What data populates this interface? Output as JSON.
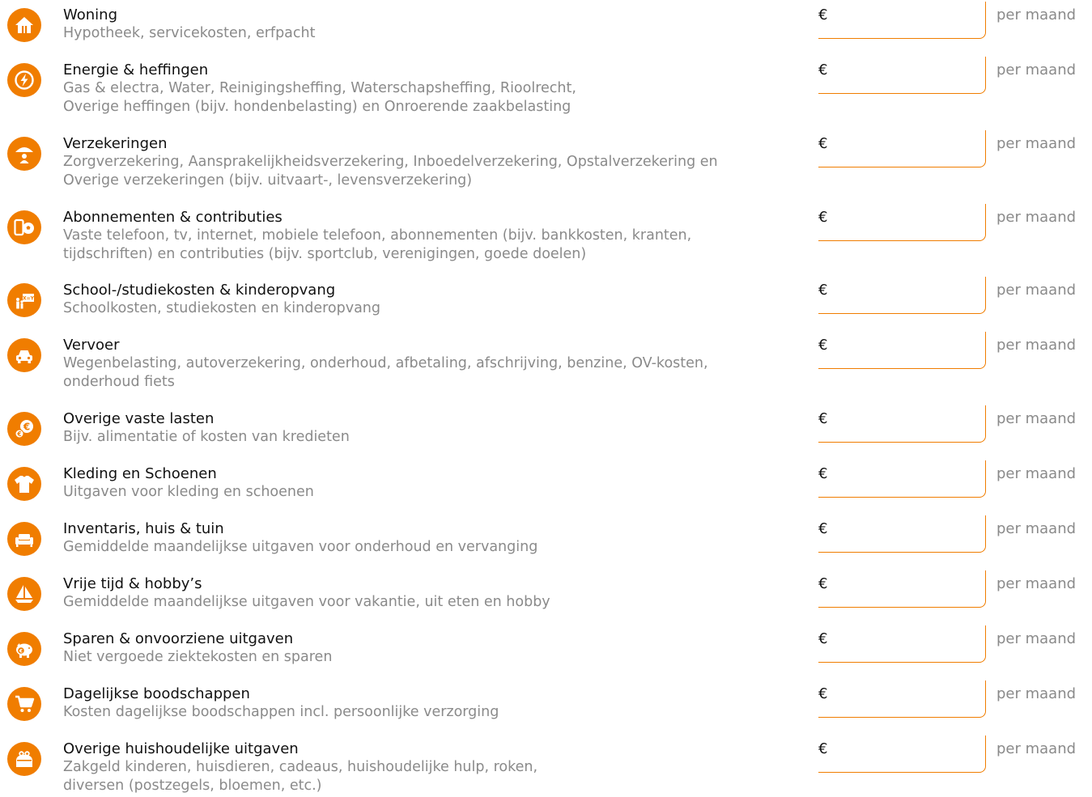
{
  "currency_symbol": "€",
  "unit_label": "per maand",
  "accent_color": "#f07d00",
  "rows": [
    {
      "icon": "house-icon",
      "title": "Woning",
      "desc": "Hypotheek, servicekosten, erfpacht",
      "value": ""
    },
    {
      "icon": "lightning-icon",
      "title": "Energie & heffingen",
      "desc": "Gas & electra, Water, Reinigingsheffing, Waterschapsheffing, Rioolrecht,\nOverige heffingen (bijv. hondenbelasting) en Onroerende zaakbelasting",
      "value": ""
    },
    {
      "icon": "umbrella-person-icon",
      "title": "Verzekeringen",
      "desc": "Zorgverzekering, Aansprakelijkheidsverzekering, Inboedelverzekering, Opstalverzekering en\nOverige verzekeringen (bijv. uitvaart-, levensverzekering)",
      "value": ""
    },
    {
      "icon": "phone-ball-icon",
      "title": "Abonnementen & contributies",
      "desc": "Vaste telefoon, tv, internet, mobiele telefoon, abonnementen (bijv. bankkosten, kranten,\ntijdschriften) en contributies (bijv. sportclub, verenigingen, goede doelen)",
      "value": ""
    },
    {
      "icon": "school-icon",
      "title": "School-/studiekosten & kinderopvang",
      "desc": "Schoolkosten, studiekosten en kinderopvang",
      "value": ""
    },
    {
      "icon": "car-icon",
      "title": "Vervoer",
      "desc": "Wegenbelasting, autoverzekering, onderhoud, afbetaling, afschrijving, benzine, OV-kosten,\nonderhoud fiets",
      "value": ""
    },
    {
      "icon": "euro-coins-icon",
      "title": "Overige vaste lasten",
      "desc": "Bijv. alimentatie of kosten van kredieten",
      "value": ""
    },
    {
      "icon": "tshirt-icon",
      "title": "Kleding en Schoenen",
      "desc": "Uitgaven voor kleding en schoenen",
      "value": ""
    },
    {
      "icon": "sofa-icon",
      "title": "Inventaris, huis & tuin",
      "desc": "Gemiddelde maandelijkse uitgaven voor onderhoud en vervanging",
      "value": ""
    },
    {
      "icon": "sailboat-icon",
      "title": "Vrije tijd & hobby’s",
      "desc": "Gemiddelde maandelijkse uitgaven voor vakantie, uit eten en hobby",
      "value": ""
    },
    {
      "icon": "piggy-bank-icon",
      "title": "Sparen & onvoorziene uitgaven",
      "desc": "Niet vergoede ziektekosten en sparen",
      "value": ""
    },
    {
      "icon": "shopping-cart-icon",
      "title": "Dagelijkse boodschappen",
      "desc": "Kosten dagelijkse boodschappen incl. persoonlijke verzorging",
      "value": ""
    },
    {
      "icon": "purse-icon",
      "title": "Overige huishoudelijke uitgaven",
      "desc": "Zakgeld kinderen, huisdieren, cadeaus, huishoudelijke hulp, roken,\ndiversen (postzegels, bloemen, etc.)",
      "value": ""
    }
  ]
}
